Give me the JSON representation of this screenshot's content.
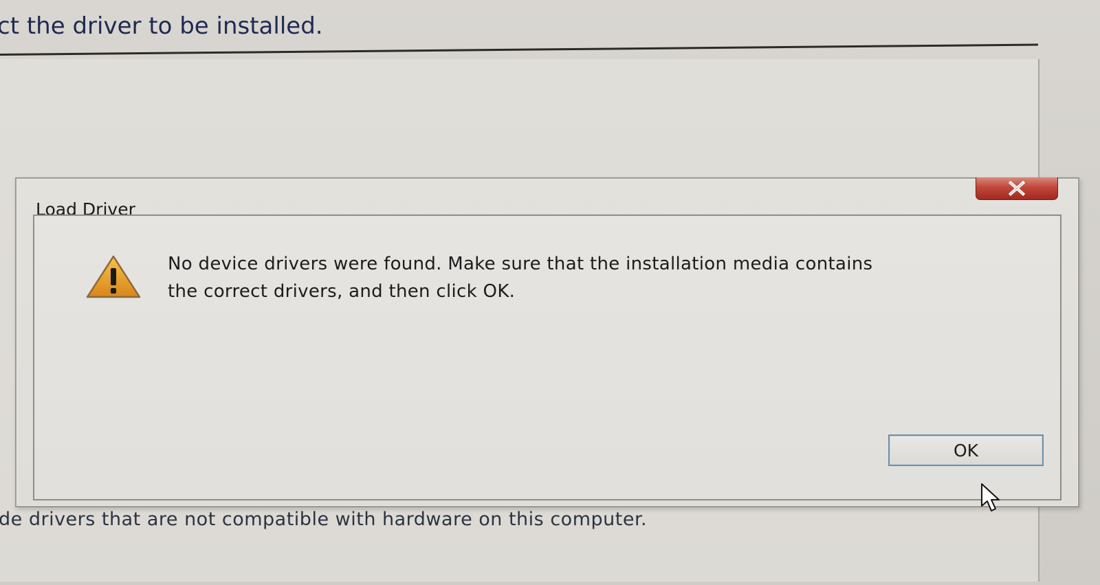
{
  "background": {
    "heading": "ct the driver to be installed.",
    "footer": "de drivers that are not compatible with hardware on this computer."
  },
  "dialog": {
    "title": "Load Driver",
    "close_icon": "close-icon",
    "warning_icon": "warning-icon",
    "message_line1": "No device drivers were found. Make sure that the installation media contains",
    "message_line2": "the correct drivers, and then click OK.",
    "ok_label": "OK"
  },
  "colors": {
    "close_button": "#c0473a",
    "warning_fill": "#e8a020",
    "heading_text": "#1e2a52"
  }
}
